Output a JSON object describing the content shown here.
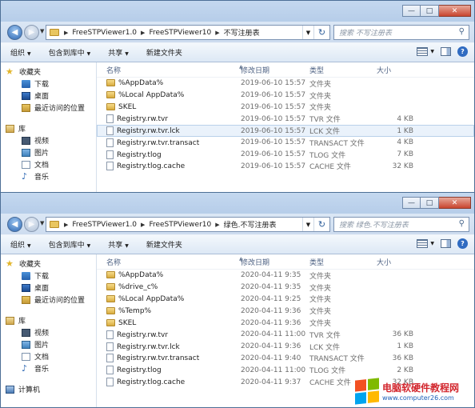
{
  "window1": {
    "caption": {
      "minimize": "—",
      "maximize": "□",
      "close": "✕"
    },
    "path": [
      "FreeSTPViewer1.0",
      "FreeSTPViewer10",
      "不写注册表"
    ],
    "search_placeholder": "搜索 不写注册表",
    "toolbar": {
      "organize": "组织",
      "include": "包含到库中",
      "share": "共享",
      "new_folder": "新建文件夹"
    },
    "nav": {
      "favorites": "收藏夹",
      "favorites_items": [
        "下载",
        "桌面",
        "最近访问的位置"
      ],
      "library": "库",
      "library_items": [
        "视频",
        "图片",
        "文档",
        "音乐"
      ]
    },
    "columns": {
      "name": "名称",
      "date": "修改日期",
      "type": "类型",
      "size": "大小"
    },
    "files": [
      {
        "name": "%AppData%",
        "date": "2019-06-10 15:57",
        "type": "文件夹",
        "size": "",
        "kind": "folder"
      },
      {
        "name": "%Local AppData%",
        "date": "2019-06-10 15:57",
        "type": "文件夹",
        "size": "",
        "kind": "folder"
      },
      {
        "name": "SKEL",
        "date": "2019-06-10 15:57",
        "type": "文件夹",
        "size": "",
        "kind": "folder"
      },
      {
        "name": "Registry.rw.tvr",
        "date": "2019-06-10 15:57",
        "type": "TVR 文件",
        "size": "4 KB",
        "kind": "file"
      },
      {
        "name": "Registry.rw.tvr.lck",
        "date": "2019-06-10 15:57",
        "type": "LCK 文件",
        "size": "1 KB",
        "kind": "file"
      },
      {
        "name": "Registry.rw.tvr.transact",
        "date": "2019-06-10 15:57",
        "type": "TRANSACT 文件",
        "size": "4 KB",
        "kind": "file"
      },
      {
        "name": "Registry.tlog",
        "date": "2019-06-10 15:57",
        "type": "TLOG 文件",
        "size": "7 KB",
        "kind": "file"
      },
      {
        "name": "Registry.tlog.cache",
        "date": "2019-06-10 15:57",
        "type": "CACHE 文件",
        "size": "32 KB",
        "kind": "file"
      }
    ]
  },
  "window2": {
    "caption": {
      "minimize": "—",
      "maximize": "□",
      "close": "✕"
    },
    "path": [
      "FreeSTPViewer1.0",
      "FreeSTPViewer10",
      "绿色.不写注册表"
    ],
    "search_placeholder": "搜索 绿色.不写注册表",
    "toolbar": {
      "organize": "组织",
      "include": "包含到库中",
      "share": "共享",
      "new_folder": "新建文件夹"
    },
    "nav": {
      "favorites": "收藏夹",
      "favorites_items": [
        "下载",
        "桌面",
        "最近访问的位置"
      ],
      "library": "库",
      "library_items": [
        "视频",
        "图片",
        "文档",
        "音乐"
      ],
      "computer": "计算机"
    },
    "columns": {
      "name": "名称",
      "date": "修改日期",
      "type": "类型",
      "size": "大小"
    },
    "files": [
      {
        "name": "%AppData%",
        "date": "2020-04-11 9:35",
        "type": "文件夹",
        "size": "",
        "kind": "folder"
      },
      {
        "name": "%drive_c%",
        "date": "2020-04-11 9:35",
        "type": "文件夹",
        "size": "",
        "kind": "folder"
      },
      {
        "name": "%Local AppData%",
        "date": "2020-04-11 9:25",
        "type": "文件夹",
        "size": "",
        "kind": "folder"
      },
      {
        "name": "%Temp%",
        "date": "2020-04-11 9:36",
        "type": "文件夹",
        "size": "",
        "kind": "folder"
      },
      {
        "name": "SKEL",
        "date": "2020-04-11 9:36",
        "type": "文件夹",
        "size": "",
        "kind": "folder"
      },
      {
        "name": "Registry.rw.tvr",
        "date": "2020-04-11 11:00",
        "type": "TVR 文件",
        "size": "36 KB",
        "kind": "file"
      },
      {
        "name": "Registry.rw.tvr.lck",
        "date": "2020-04-11 9:36",
        "type": "LCK 文件",
        "size": "1 KB",
        "kind": "file"
      },
      {
        "name": "Registry.rw.tvr.transact",
        "date": "2020-04-11 9:40",
        "type": "TRANSACT 文件",
        "size": "36 KB",
        "kind": "file"
      },
      {
        "name": "Registry.tlog",
        "date": "2020-04-11 11:00",
        "type": "TLOG 文件",
        "size": "2 KB",
        "kind": "file"
      },
      {
        "name": "Registry.tlog.cache",
        "date": "2020-04-11 9:37",
        "type": "CACHE 文件",
        "size": "32 KB",
        "kind": "file"
      }
    ]
  },
  "watermark": {
    "line1": "电脑软硬件教程网",
    "line2": "www.computer26.com"
  }
}
